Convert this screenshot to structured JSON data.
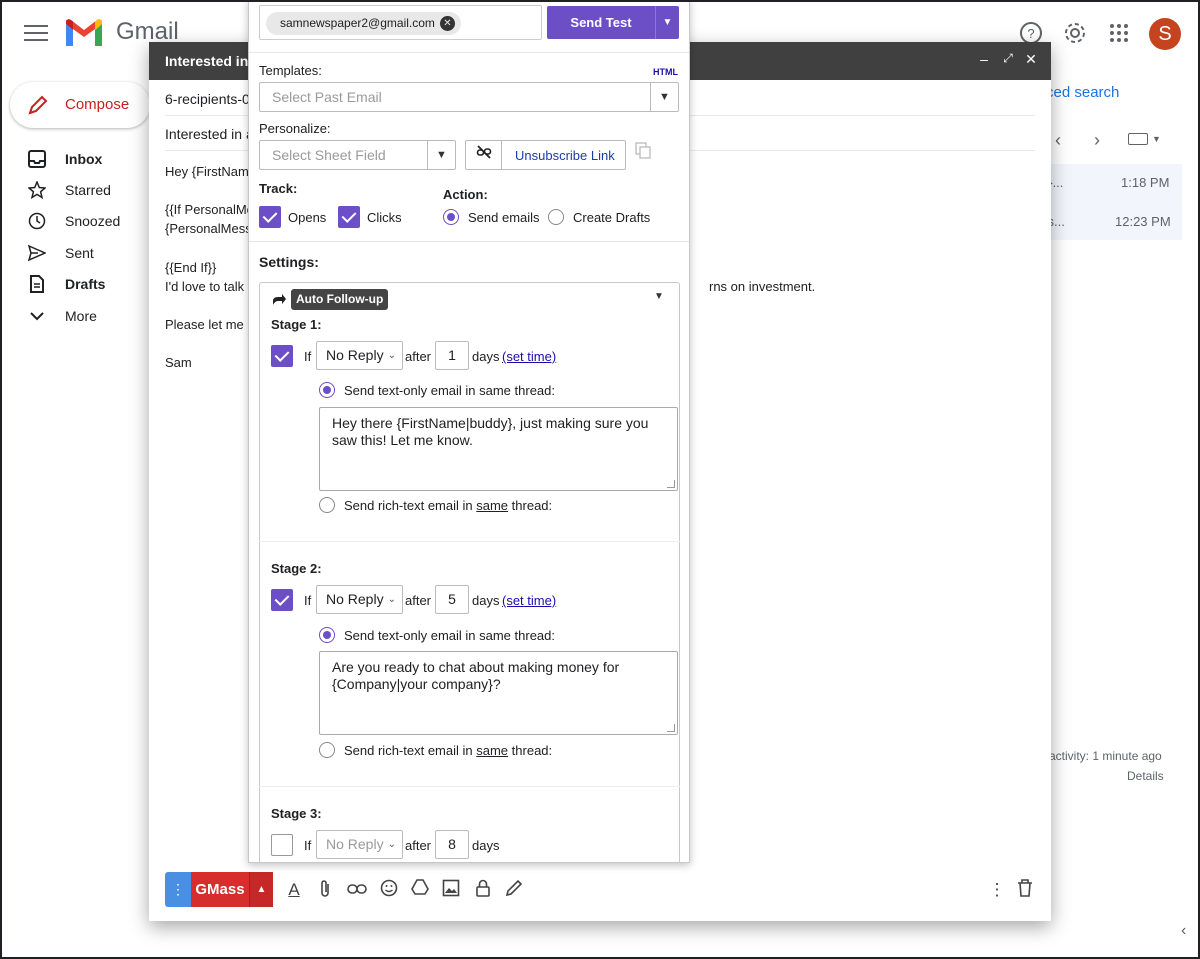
{
  "gmail": {
    "logo_text": "Gmail",
    "compose_label": "Compose",
    "avatar_initial": "S",
    "nav": [
      {
        "label": "Inbox",
        "icon": "inbox-icon"
      },
      {
        "label": "Starred",
        "icon": "star-icon"
      },
      {
        "label": "Snoozed",
        "icon": "clock-icon"
      },
      {
        "label": "Sent",
        "icon": "send-icon"
      },
      {
        "label": "Drafts",
        "icon": "draft-icon"
      },
      {
        "label": "More",
        "icon": "chevron-down-icon"
      }
    ],
    "advanced_search_fragment": "ced search",
    "rows": [
      {
        "snippet_fragment": "n}...",
        "time": "1:18 PM"
      },
      {
        "snippet_fragment": "ss...",
        "time": "12:23 PM"
      }
    ],
    "activity_fragment": "activity: 1 minute ago",
    "details_label": "Details"
  },
  "compose": {
    "title_fragment": "Interested in",
    "to_fragment": "6-recipients-0",
    "subject_fragment": "Interested in a",
    "body_lines": [
      "Hey {FirstNam",
      "{{If PersonalMe",
      "{PersonalMess",
      "{{End If}}",
      "I'd love to talk v",
      "rns on investment.",
      "Please let me l",
      "Sam"
    ],
    "gmass_label": "GMass",
    "dots_label": "⋮"
  },
  "gmass_panel": {
    "test_email": "samnewspaper2@gmail.com",
    "send_test_label": "Send Test",
    "templates_label": "Templates:",
    "html_link": "HTML",
    "templates_placeholder": "Select Past Email",
    "personalize_label": "Personalize:",
    "personalize_placeholder": "Select Sheet Field",
    "unsubscribe_label": "Unsubscribe Link",
    "track_label": "Track:",
    "opens_label": "Opens",
    "clicks_label": "Clicks",
    "action_label": "Action:",
    "send_emails_label": "Send emails",
    "create_drafts_label": "Create Drafts",
    "settings_label": "Settings:",
    "auto_followup_label": "Auto Follow-up",
    "if_label": "If",
    "after_label": "after",
    "days_label": "days",
    "set_time_label": "(set time)",
    "send_text_only_label": "Send text-only email in same thread:",
    "send_rich_prefix": "Send rich-text email in",
    "send_rich_same": "same",
    "send_rich_suffix": "thread:",
    "stages": [
      {
        "label": "Stage 1:",
        "checked": true,
        "condition": "No Reply",
        "days": "1",
        "text": "Hey there {FirstName|buddy}, just making sure you saw this! Let me know."
      },
      {
        "label": "Stage 2:",
        "checked": true,
        "condition": "No Reply",
        "days": "5",
        "text": "Are you ready to chat about making money for {Company|your company}?"
      },
      {
        "label": "Stage 3:",
        "checked": false,
        "condition": "No Reply",
        "days": "8"
      }
    ]
  },
  "colors": {
    "gmass_purple": "#6c4fc7",
    "gmass_red": "#d62d2d",
    "compose_header": "#404040",
    "avatar": "#c5431e"
  }
}
